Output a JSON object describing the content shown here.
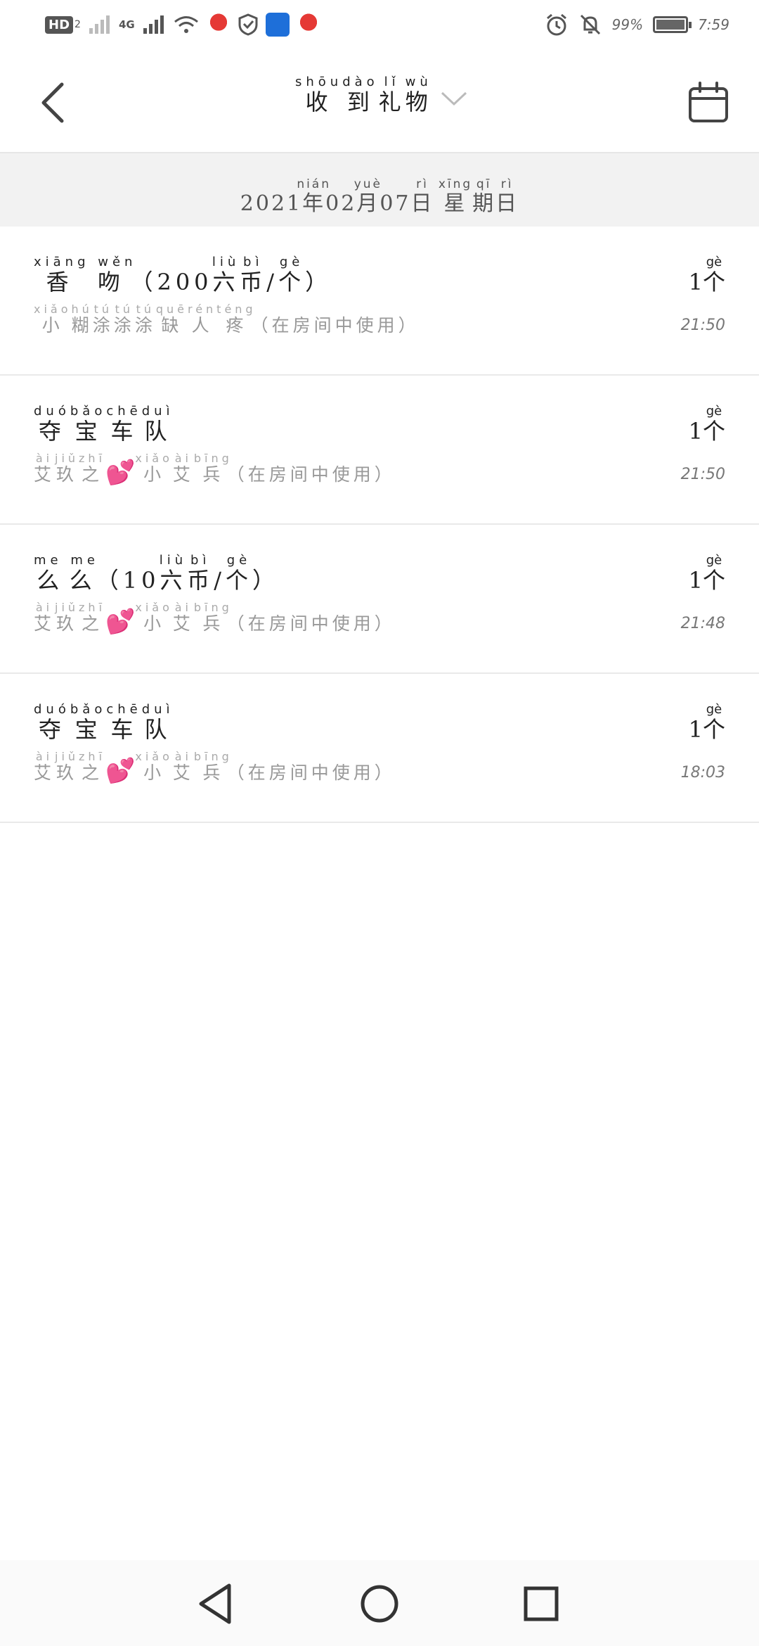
{
  "status_bar": {
    "hd_label": "HD",
    "hd_sub": "2",
    "network": "4G",
    "battery_percent": "99%",
    "battery_level": 0.99,
    "time": "7:59"
  },
  "header": {
    "title": [
      {
        "char": "收",
        "pinyin": "shōu"
      },
      {
        "char": "到",
        "pinyin": "dào"
      },
      {
        "char": "礼",
        "pinyin": "lǐ"
      },
      {
        "char": "物",
        "pinyin": "wù"
      }
    ]
  },
  "date_bar": {
    "year": "2021",
    "nian": {
      "char": "年",
      "pinyin": "nián"
    },
    "month": "02",
    "yue": {
      "char": "月",
      "pinyin": "yuè"
    },
    "day": "07",
    "ri": {
      "char": "日",
      "pinyin": "rì"
    },
    "weekday": [
      {
        "char": "星",
        "pinyin": "xīng"
      },
      {
        "char": "期",
        "pinyin": "qī"
      },
      {
        "char": "日",
        "pinyin": "rì"
      }
    ]
  },
  "gifts": [
    {
      "name_a": {
        "char": "香吻",
        "pinyin": "xiāng wěn"
      },
      "name_paren": "（200",
      "coin": [
        {
          "char": "六",
          "pinyin": "liù"
        },
        {
          "char": "币",
          "pinyin": "bì"
        }
      ],
      "slash": "/",
      "unit": {
        "char": "个",
        "pinyin": "gè"
      },
      "close": "）",
      "sub": [
        {
          "char": "小",
          "pinyin": "xiǎo"
        },
        {
          "char": "糊",
          "pinyin": "hú"
        },
        {
          "char": "涂",
          "pinyin": "tú"
        },
        {
          "char": "涂",
          "pinyin": "tú"
        },
        {
          "char": "涂",
          "pinyin": "tú"
        },
        {
          "char": "缺",
          "pinyin": "quē"
        },
        {
          "char": "人",
          "pinyin": "rén"
        },
        {
          "char": "疼",
          "pinyin": "téng"
        }
      ],
      "sub_suffix": "（在房间中使用）",
      "count": "1",
      "count_unit": {
        "char": "个",
        "pinyin": "gè"
      },
      "time": "21:50"
    },
    {
      "name_b": [
        {
          "char": "夺",
          "pinyin": "duó"
        },
        {
          "char": "宝",
          "pinyin": "bǎo"
        },
        {
          "char": "车",
          "pinyin": "chē"
        },
        {
          "char": "队",
          "pinyin": "duì"
        }
      ],
      "sub_pre": [
        {
          "char": "艾",
          "pinyin": "ài"
        },
        {
          "char": "玖",
          "pinyin": "jiǔ"
        },
        {
          "char": "之",
          "pinyin": "zhī"
        }
      ],
      "heart": "💕",
      "sub_post": [
        {
          "char": "小",
          "pinyin": "xiǎo"
        },
        {
          "char": "艾",
          "pinyin": "ài"
        },
        {
          "char": "兵",
          "pinyin": "bīng"
        }
      ],
      "sub_suffix": "（在房间中使用）",
      "count": "1",
      "count_unit": {
        "char": "个",
        "pinyin": "gè"
      },
      "time": "21:50"
    },
    {
      "name_a": {
        "char": "么么",
        "pinyin": "me me"
      },
      "name_paren": "（10",
      "coin": [
        {
          "char": "六",
          "pinyin": "liù"
        },
        {
          "char": "币",
          "pinyin": "bì"
        }
      ],
      "slash": "/",
      "unit": {
        "char": "个",
        "pinyin": "gè"
      },
      "close": "）",
      "sub_pre": [
        {
          "char": "艾",
          "pinyin": "ài"
        },
        {
          "char": "玖",
          "pinyin": "jiǔ"
        },
        {
          "char": "之",
          "pinyin": "zhī"
        }
      ],
      "heart": "💕",
      "sub_post": [
        {
          "char": "小",
          "pinyin": "xiǎo"
        },
        {
          "char": "艾",
          "pinyin": "ài"
        },
        {
          "char": "兵",
          "pinyin": "bīng"
        }
      ],
      "sub_suffix": "（在房间中使用）",
      "count": "1",
      "count_unit": {
        "char": "个",
        "pinyin": "gè"
      },
      "time": "21:48"
    },
    {
      "name_b": [
        {
          "char": "夺",
          "pinyin": "duó"
        },
        {
          "char": "宝",
          "pinyin": "bǎo"
        },
        {
          "char": "车",
          "pinyin": "chē"
        },
        {
          "char": "队",
          "pinyin": "duì"
        }
      ],
      "sub_pre": [
        {
          "char": "艾",
          "pinyin": "ài"
        },
        {
          "char": "玖",
          "pinyin": "jiǔ"
        },
        {
          "char": "之",
          "pinyin": "zhī"
        }
      ],
      "heart": "💕",
      "sub_post": [
        {
          "char": "小",
          "pinyin": "xiǎo"
        },
        {
          "char": "艾",
          "pinyin": "ài"
        },
        {
          "char": "兵",
          "pinyin": "bīng"
        }
      ],
      "sub_suffix": "（在房间中使用）",
      "count": "1",
      "count_unit": {
        "char": "个",
        "pinyin": "gè"
      },
      "time": "18:03"
    }
  ],
  "icons": {
    "back": "back-arrow-icon",
    "title_dropdown": "chevron-down-icon",
    "calendar": "calendar-icon",
    "nav_back": "triangle-back-icon",
    "nav_home": "circle-home-icon",
    "nav_recent": "square-recent-icon"
  },
  "colors": {
    "date_bar_bg": "#f2f2f2",
    "heart": "#e84b8a",
    "sub_text": "#999999"
  }
}
